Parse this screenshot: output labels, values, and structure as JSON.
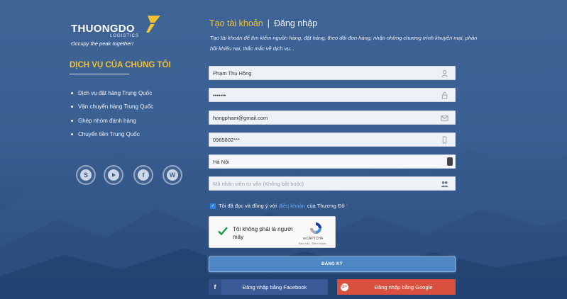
{
  "brand": {
    "name": "THUONGDO",
    "subtitle": "LOGISTICS",
    "slogan": "Occupy the peak together!"
  },
  "services": {
    "title": "DỊCH VỤ CỦA CHÚNG TÔI",
    "items": [
      "Dịch vụ đặt hàng Trung Quốc",
      "Vận chuyển hàng Trung Quốc",
      "Ghép nhóm đánh hàng",
      "Chuyển tiền Trung Quốc"
    ]
  },
  "social": {
    "skype": "S",
    "facebook": "f",
    "whatsapp": "W"
  },
  "tabs": {
    "register": "Tạo tài khoản",
    "separator": "|",
    "login": "Đăng nhập"
  },
  "intro": "Tạo tài khoản để tìm kiếm nguồn hàng, đặt hàng, theo dõi đơn hàng, nhận những chương trình khuyến mại, phản hồi khiếu nại, thắc mắc về dịch vụ...",
  "form": {
    "name_value": "Phạm Thu Hồng",
    "password_value": "•••••••",
    "email_value": "hongpham@gmail.com",
    "phone_value": "0965802***",
    "city_selected": "Hà Nội",
    "consultant_placeholder": "Mã nhân viên tư vấn (Không bắt buộc)",
    "agree_prefix": "Tôi đã đọc và đồng ý với",
    "agree_link": "điều khoản",
    "agree_suffix": "của Thương Đô",
    "agree_required": "*",
    "submit_label": "ĐĂNG KÝ"
  },
  "captcha": {
    "label": "Tôi không phải là người máy",
    "brand": "reCAPTCHA",
    "terms": "Bảo mật - Điều khoản"
  },
  "social_login": {
    "facebook_label": "Đăng nhập bằng Facebook",
    "facebook_icon": "f",
    "google_label": "Đăng nhập bằng Google",
    "google_icon": "G+"
  },
  "colors": {
    "accent_yellow": "#f2c230",
    "submit_blue": "#4f87c4",
    "facebook_blue": "#3b5a98",
    "google_red": "#d9503f"
  }
}
